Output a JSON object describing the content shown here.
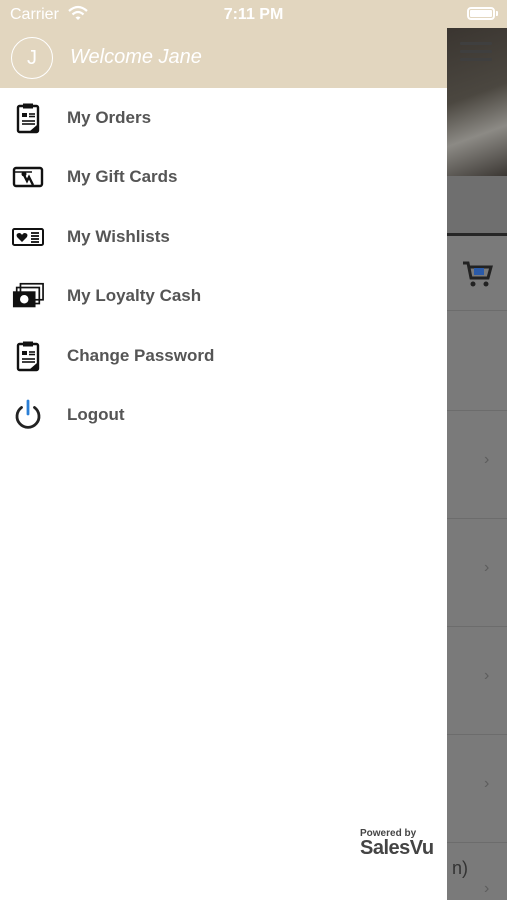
{
  "status_bar": {
    "carrier": "Carrier",
    "time": "7:11 PM"
  },
  "drawer": {
    "avatar_initial": "J",
    "welcome_text": "Welcome Jane",
    "menu": [
      {
        "label": "My Orders",
        "icon": "clipboard-icon"
      },
      {
        "label": "My Gift Cards",
        "icon": "gift-card-icon"
      },
      {
        "label": "My Wishlists",
        "icon": "wishlist-icon"
      },
      {
        "label": "My Loyalty Cash",
        "icon": "cash-stack-icon"
      },
      {
        "label": "Change Password",
        "icon": "clipboard-icon"
      },
      {
        "label": "Logout",
        "icon": "power-icon"
      }
    ],
    "footer": {
      "powered_by": "Powered by",
      "brand": "SalesVu"
    }
  },
  "background_page": {
    "partial_text": "n)"
  },
  "colors": {
    "header_bg": "#e2d6bf",
    "label_text": "#555555",
    "overlay": "#7a7a7a",
    "logout_accent": "#2b7fd6"
  }
}
